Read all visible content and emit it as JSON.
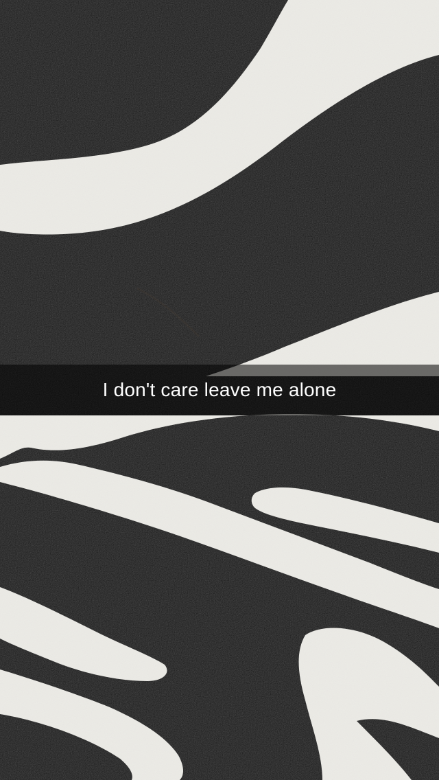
{
  "snap": {
    "caption": "I don't care leave me alone"
  },
  "colors": {
    "fabric_dark": "#1e1e1e",
    "fabric_light": "#ecebe6",
    "caption_text": "#ffffff"
  }
}
